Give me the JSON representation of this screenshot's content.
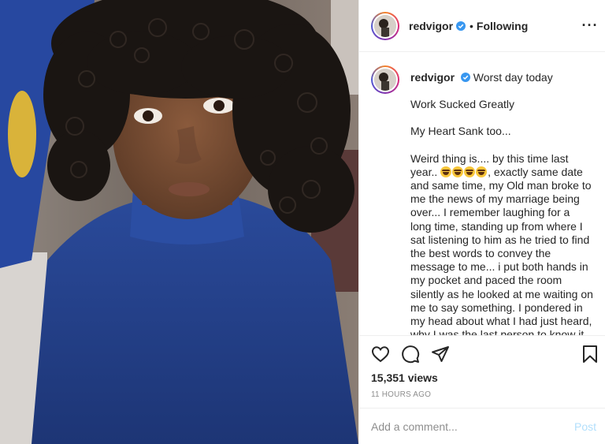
{
  "post": {
    "username": "redvigor",
    "follow_status": "Following",
    "separator": "•",
    "views": "15,351 views",
    "time_ago": "11 HOURS AGO"
  },
  "caption": {
    "username": "redvigor",
    "line1": "Worst day today",
    "para1": "Work Sucked Greatly",
    "para2": "My Heart Sank too...",
    "para3_before_emoji": "Weird thing is.... by this time last year..",
    "para3_after_emoji": ", exactly same date and same time, my Old man broke to me the news of my marriage being over... I remember laughing for a long time, standing up from where I sat listening to him as he tried to find the best words to convey the message to me... i put both hands in my pocket and paced the room silently as he looked at me waiting on me to say something. I pondered in my head about what I had just heard, why I was the last person to know it and how in"
  },
  "comment_box": {
    "placeholder": "Add a comment...",
    "post_label": "Post"
  },
  "icons": {
    "more": "more-options-icon",
    "like": "heart-icon",
    "comment": "comment-icon",
    "share": "share-icon",
    "save": "bookmark-icon",
    "verified": "verified-badge-icon",
    "emoji": "laughing-face-emoji"
  },
  "colors": {
    "verified_blue": "#3897f0",
    "post_disabled": "#b2dffc",
    "muted_text": "#8e8e8e"
  }
}
